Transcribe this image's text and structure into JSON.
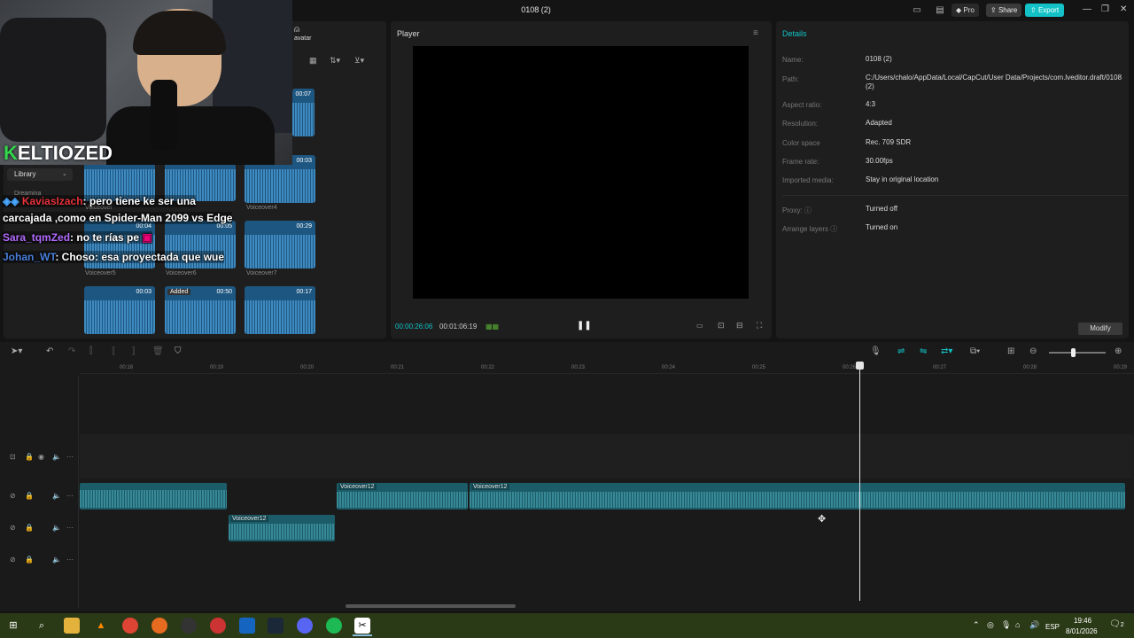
{
  "window": {
    "title": "0108 (2)",
    "pro_label": "Pro",
    "share_label": "Share",
    "export_label": "Export"
  },
  "media": {
    "avatar_label": "avatar",
    "library_label": "Library",
    "dreamina_label": "Dreamina",
    "thumbs": [
      {
        "duration": "00:07",
        "label": ""
      },
      {
        "duration": "00:03",
        "label": "Voiceover4"
      },
      {
        "duration": "00:04",
        "label": "Voiceover"
      },
      {
        "duration": "00:05",
        "label": "Voiceover"
      },
      {
        "duration": "00:29",
        "label": "Voiceover7"
      },
      {
        "duration": "",
        "label": "Voiceover5"
      },
      {
        "duration": "",
        "label": "Voiceover6"
      },
      {
        "duration": "00:03",
        "label": ""
      },
      {
        "duration": "00:50",
        "label": "",
        "badge": "Added"
      },
      {
        "duration": "00:17",
        "label": ""
      }
    ]
  },
  "overlay": {
    "channel": "ELTIOZED",
    "channel_prefix": "K"
  },
  "chat": [
    {
      "user": "KaviasIzach",
      "user_color": "#e8333c",
      "text": ": pero tiene ke ser una"
    },
    {
      "user": "",
      "user_color": "#ffffff",
      "text": "carcajada ,como en Spider-Man 2099 vs Edge"
    },
    {
      "user": "Sara_tqmZed",
      "user_color": "#b36cff",
      "text": ": no te rías pe"
    },
    {
      "user": "Johan_WT",
      "user_color": "#4a7fdb",
      "text": ": Choso: esa proyectada que wue"
    }
  ],
  "player": {
    "title": "Player",
    "time_current": "00:00:26:06",
    "time_total": "00:01:06:19",
    "pause_icon": "pause-icon"
  },
  "details": {
    "title": "Details",
    "fields": [
      {
        "label": "Name:",
        "value": "0108 (2)"
      },
      {
        "label": "Path:",
        "value": "C:/Users/chalo/AppData/Local/CapCut/User Data/Projects/com.lveditor.draft/0108 (2)"
      },
      {
        "label": "Aspect ratio:",
        "value": "4:3"
      },
      {
        "label": "Resolution:",
        "value": "Adapted"
      },
      {
        "label": "Color space",
        "value": "Rec. 709 SDR"
      },
      {
        "label": "Frame rate:",
        "value": "30.00fps"
      },
      {
        "label": "Imported media:",
        "value": "Stay in original location"
      },
      {
        "label": "Proxy:",
        "value": "Turned off"
      },
      {
        "label": "Arrange layers",
        "value": "Turned on"
      }
    ],
    "modify_label": "Modify"
  },
  "timeline": {
    "ticks": [
      "00:18",
      "00:19",
      "00:20",
      "00:21",
      "00:22",
      "00:23",
      "00:24",
      "00:25",
      "00:26",
      "00:27",
      "00:28",
      "00:29"
    ],
    "clips": [
      "Voiceover12",
      "Voiceover12",
      "Voiceover12"
    ]
  },
  "taskbar": {
    "time": "19:46",
    "date": "8/01/2026",
    "lang": "ESP",
    "notifications": "2"
  },
  "colors": {
    "accent": "#12c2c6",
    "background": "#141414",
    "panel": "#1e1e1e",
    "clip": "#1b5c68"
  }
}
